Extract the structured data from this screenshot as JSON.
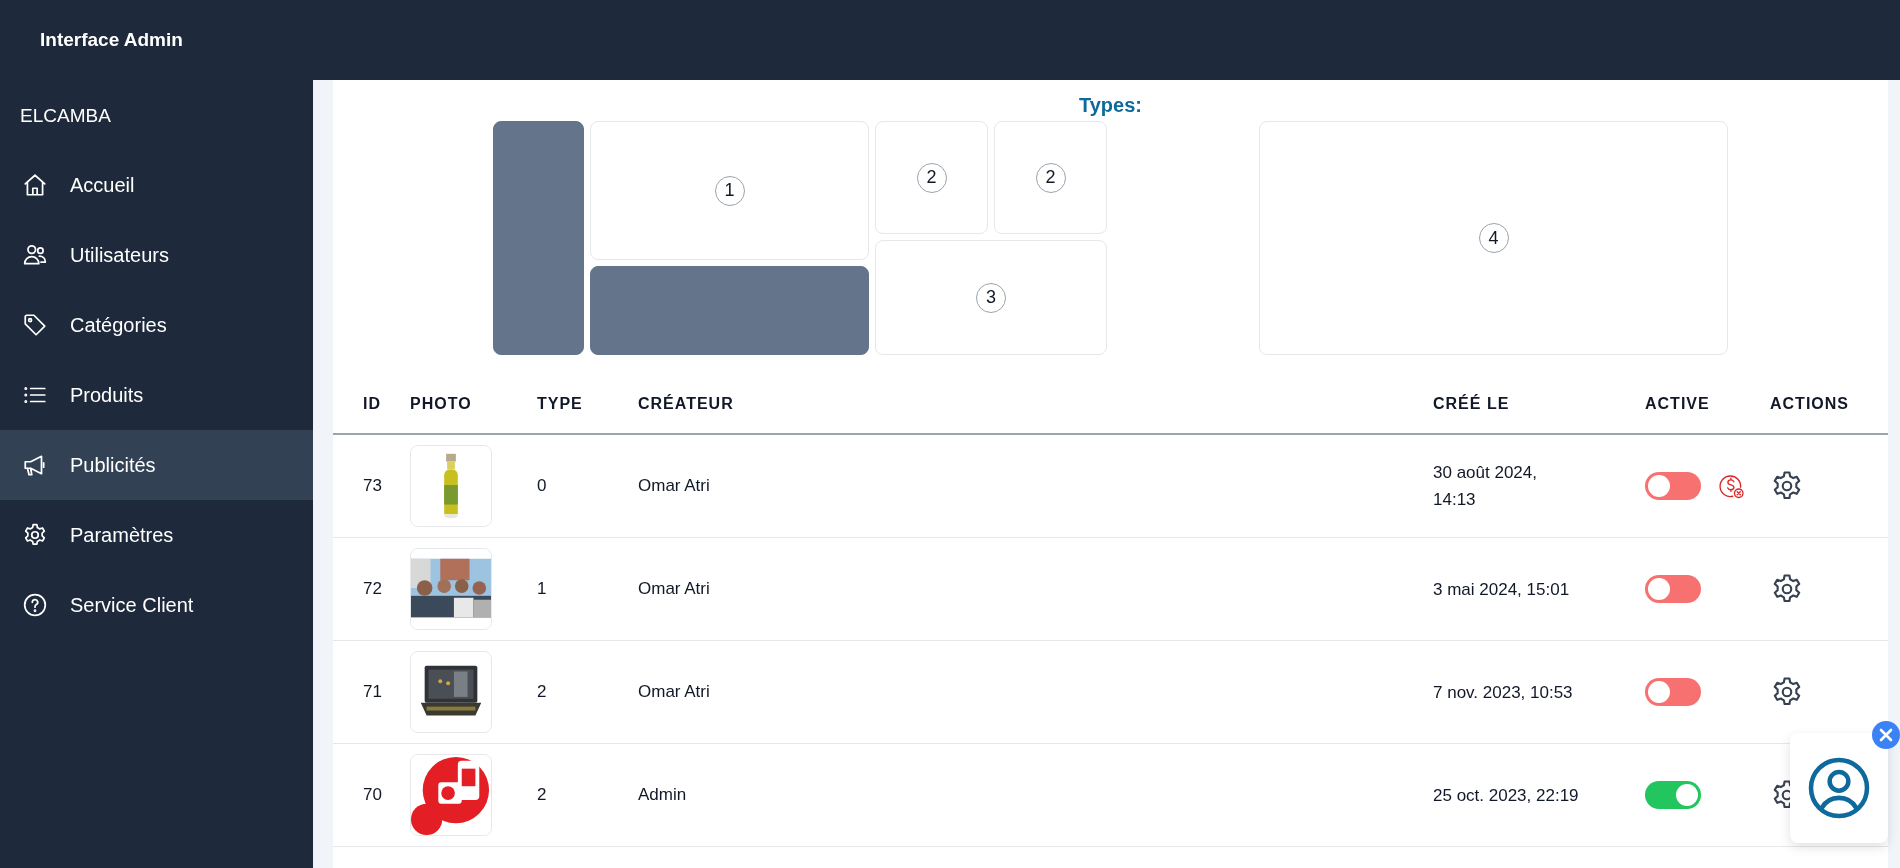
{
  "header": {
    "title": "Interface Admin"
  },
  "sidebar": {
    "brand": "ELCAMBA",
    "items": [
      {
        "label": "Accueil",
        "selected": false
      },
      {
        "label": "Utilisateurs",
        "selected": false
      },
      {
        "label": "Catégories",
        "selected": false
      },
      {
        "label": "Produits",
        "selected": false
      },
      {
        "label": "Publicités",
        "selected": true
      },
      {
        "label": "Paramètres",
        "selected": false
      },
      {
        "label": "Service Client",
        "selected": false
      }
    ]
  },
  "types_diagram": {
    "title": "Types:",
    "slots": [
      {
        "kind": "filled"
      },
      {
        "kind": "numbered",
        "label": "1"
      },
      {
        "kind": "filled"
      },
      {
        "kind": "numbered",
        "label": "2"
      },
      {
        "kind": "numbered",
        "label": "2"
      },
      {
        "kind": "numbered",
        "label": "3"
      },
      {
        "kind": "numbered",
        "label": "4"
      }
    ]
  },
  "table": {
    "columns": [
      "ID",
      "PHOTO",
      "TYPE",
      "CRÉATEUR",
      "CRÉÉ LE",
      "ACTIVE",
      "ACTIONS"
    ],
    "rows": [
      {
        "id": "73",
        "type": "0",
        "creator": "Omar Atri",
        "created": "30 août 2024, 14:13",
        "active": false,
        "unpaid": true
      },
      {
        "id": "72",
        "type": "1",
        "creator": "Omar Atri",
        "created": "3 mai 2024, 15:01",
        "active": false,
        "unpaid": false
      },
      {
        "id": "71",
        "type": "2",
        "creator": "Omar Atri",
        "created": "7 nov. 2023, 10:53",
        "active": false,
        "unpaid": false
      },
      {
        "id": "70",
        "type": "2",
        "creator": "Admin",
        "created": "25 oct. 2023, 22:19",
        "active": true,
        "unpaid": false
      }
    ]
  },
  "support_widget": {
    "open": true
  }
}
